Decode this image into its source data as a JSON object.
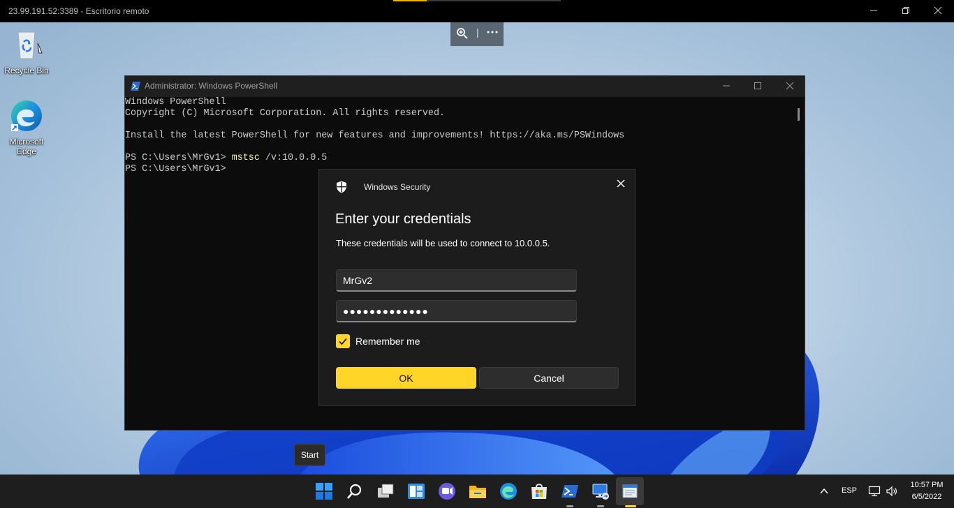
{
  "rdp": {
    "title": "23.99.191.52:3389 - Escritorio remoto",
    "progress_fraction": 0.2
  },
  "desktop": {
    "icons": [
      {
        "label": "Recycle Bin",
        "icon": "recycle-bin-icon"
      },
      {
        "label": "Microsoft Edge",
        "icon": "edge-icon"
      }
    ]
  },
  "powershell": {
    "title": "Administrator: Windows PowerShell",
    "lines": [
      {
        "text": "Windows PowerShell"
      },
      {
        "text": "Copyright (C) Microsoft Corporation. All rights reserved."
      },
      {
        "text": ""
      },
      {
        "text": "Install the latest PowerShell for new features and improvements! https://aka.ms/PSWindows"
      },
      {
        "text": ""
      },
      {
        "prompt": "PS C:\\Users\\MrGv1> ",
        "cmd": "mstsc",
        "args": " /v:10.0.0.5"
      },
      {
        "prompt": "PS C:\\Users\\MrGv1> ",
        "cmd": "",
        "args": ""
      }
    ],
    "colors": {
      "cmd": "#f9f1a5",
      "text": "#cccccc"
    }
  },
  "dialog": {
    "app_title": "Windows Security",
    "heading": "Enter your credentials",
    "description": "These credentials will be used to connect to 10.0.0.5.",
    "username": "MrGv2",
    "password_mask": "●●●●●●●●●●●●●",
    "remember_label": "Remember me",
    "remember_checked": true,
    "ok_label": "OK",
    "cancel_label": "Cancel",
    "accent": "#ffd628"
  },
  "tooltip": {
    "start": "Start"
  },
  "taskbar": {
    "apps": [
      "start-icon",
      "search-icon",
      "task-view-icon",
      "widgets-icon",
      "chat-icon",
      "file-explorer-icon",
      "edge-icon",
      "store-icon",
      "powershell-icon",
      "remote-desktop-icon",
      "notepad-icon"
    ],
    "tray": {
      "language": "ESP",
      "time": "10:57 PM",
      "date": "6/5/2022"
    }
  }
}
